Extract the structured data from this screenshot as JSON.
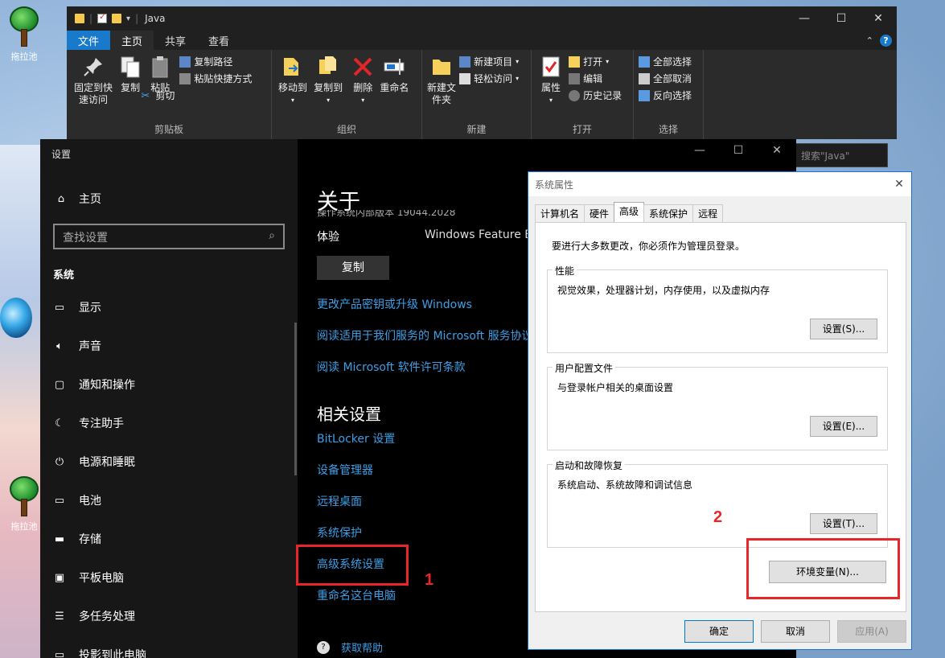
{
  "desktop": {
    "icons": [
      {
        "label": "拖拉池"
      },
      {
        "label": "拖拉池"
      }
    ]
  },
  "explorer": {
    "title": "Java",
    "tabs": {
      "file": "文件",
      "home": "主页",
      "share": "共享",
      "view": "查看"
    },
    "search_placeholder": "搜索\"Java\"",
    "groups": {
      "clipboard": {
        "label": "剪贴板",
        "pin": "固定到快速访问",
        "copy": "复制",
        "paste": "粘贴",
        "copy_path": "复制路径",
        "paste_shortcut": "粘贴快捷方式",
        "cut": "剪切"
      },
      "organize": {
        "label": "组织",
        "move_to": "移动到",
        "copy_to": "复制到",
        "delete": "删除",
        "rename": "重命名"
      },
      "new": {
        "label": "新建",
        "new_folder": "新建文件夹",
        "new_item": "新建项目",
        "easy_access": "轻松访问"
      },
      "open": {
        "label": "打开",
        "properties": "属性",
        "open": "打开",
        "edit": "编辑",
        "history": "历史记录"
      },
      "select": {
        "label": "选择",
        "select_all": "全部选择",
        "select_none": "全部取消",
        "invert": "反向选择"
      }
    }
  },
  "settings": {
    "title": "设置",
    "home": "主页",
    "search_placeholder": "查找设置",
    "section": "系统",
    "nav": [
      "显示",
      "声音",
      "通知和操作",
      "专注助手",
      "电源和睡眠",
      "电池",
      "存储",
      "平板电脑",
      "多任务处理",
      "投影到此电脑"
    ],
    "main": {
      "heading": "关于",
      "partial_row": "操作系统内部版本    19044.2028",
      "experience_label": "体验",
      "experience_value": "Windows Feature Ex",
      "copy": "复制",
      "links": [
        "更改产品密钥或升级 Windows",
        "阅读适用于我们服务的 Microsoft 服务协议",
        "阅读 Microsoft 软件许可条款"
      ],
      "related_heading": "相关设置",
      "related_links": [
        "BitLocker 设置",
        "设备管理器",
        "远程桌面",
        "系统保护",
        "高级系统设置",
        "重命名这台电脑"
      ],
      "help": "获取帮助"
    }
  },
  "dialog": {
    "title": "系统属性",
    "tabs": [
      "计算机名",
      "硬件",
      "高级",
      "系统保护",
      "远程"
    ],
    "active_tab": "高级",
    "admin_note": "要进行大多数更改，你必须作为管理员登录。",
    "performance": {
      "legend": "性能",
      "desc": "视觉效果，处理器计划，内存使用，以及虚拟内存",
      "button": "设置(S)..."
    },
    "profiles": {
      "legend": "用户配置文件",
      "desc": "与登录帐户相关的桌面设置",
      "button": "设置(E)..."
    },
    "startup": {
      "legend": "启动和故障恢复",
      "desc": "系统启动、系统故障和调试信息",
      "button": "设置(T)..."
    },
    "env_button": "环境变量(N)...",
    "ok": "确定",
    "cancel": "取消",
    "apply": "应用(A)"
  },
  "annotations": {
    "step1": "1",
    "step2": "2"
  },
  "colors": {
    "link": "#3c9fe7",
    "annotation": "#e8262a",
    "accent": "#1979ca"
  }
}
